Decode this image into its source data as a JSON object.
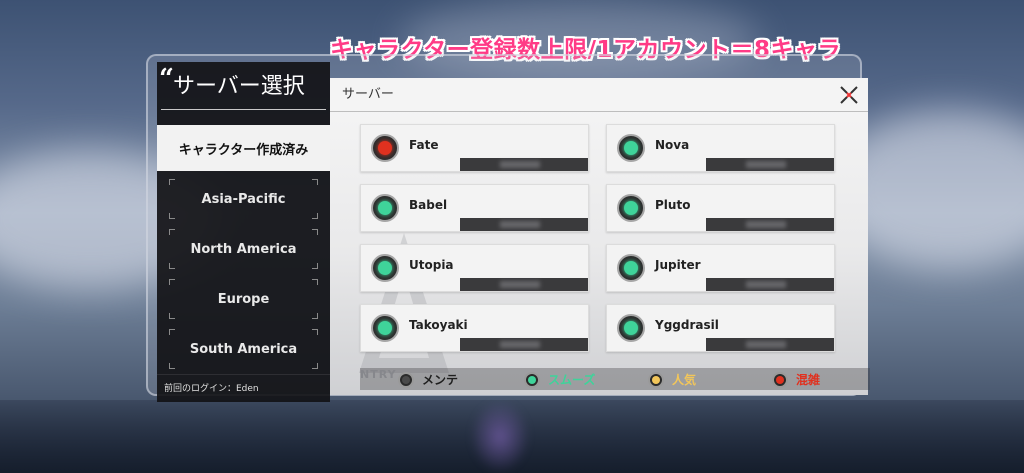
{
  "caption": "キャラクター登録数上限/1アカウント＝8キャラ",
  "sidebar": {
    "title": "サーバー選択",
    "active_region": "キャラクター作成済み",
    "regions": [
      "Asia-Pacific",
      "North America",
      "Europe",
      "South America"
    ],
    "last_login": "前回のログイン：Eden"
  },
  "panel": {
    "header": "サーバー",
    "watermark_text": "NTRY",
    "servers": [
      {
        "name": "Fate",
        "status": "red"
      },
      {
        "name": "Nova",
        "status": "green"
      },
      {
        "name": "Babel",
        "status": "green"
      },
      {
        "name": "Pluto",
        "status": "green"
      },
      {
        "name": "Utopia",
        "status": "green"
      },
      {
        "name": "Jupiter",
        "status": "green"
      },
      {
        "name": "Takoyaki",
        "status": "green"
      },
      {
        "name": "Yggdrasil",
        "status": "green"
      }
    ]
  },
  "legend": {
    "maintenance": "メンテ",
    "smooth": "スムーズ",
    "popular": "人気",
    "crowded": "混雑"
  },
  "colors": {
    "green": "#3fd39a",
    "red": "#e0311f",
    "yellow": "#f2c65a",
    "gray": "#4a4a4a",
    "caption": "#ff3b86"
  }
}
